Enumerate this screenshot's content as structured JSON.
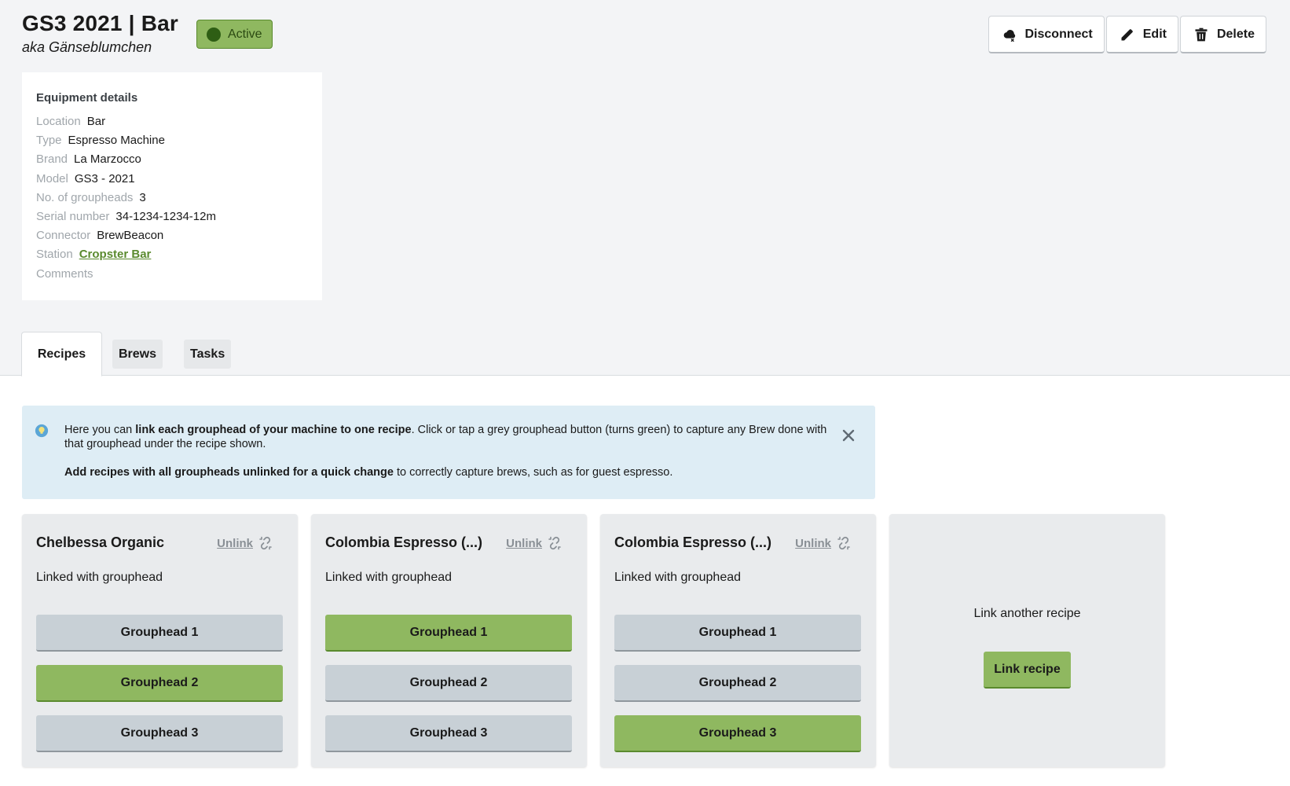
{
  "header": {
    "title": "GS3 2021 | Bar",
    "subtitle": "aka Gänseblumchen",
    "status": "Active",
    "actions": {
      "disconnect": "Disconnect",
      "edit": "Edit",
      "delete": "Delete"
    }
  },
  "details": {
    "heading": "Equipment details",
    "rows": [
      {
        "label": "Location",
        "value": "Bar"
      },
      {
        "label": "Type",
        "value": "Espresso Machine"
      },
      {
        "label": "Brand",
        "value": "La Marzocco"
      },
      {
        "label": "Model",
        "value": "GS3 - 2021"
      },
      {
        "label": "No. of groupheads",
        "value": "3"
      },
      {
        "label": "Serial number",
        "value": "34-1234-1234-12m"
      },
      {
        "label": "Connector",
        "value": "BrewBeacon"
      },
      {
        "label": "Station",
        "value": "Cropster Bar"
      },
      {
        "label": "Comments",
        "value": ""
      }
    ]
  },
  "tabs": [
    "Recipes",
    "Brews",
    "Tasks"
  ],
  "info": {
    "p1_before": "Here you can ",
    "p1_bold": "link each grouphead of your machine to one recipe",
    "p1_after": ". Click or tap a grey grouphead button (turns green) to capture any Brew done with that grouphead under the recipe shown.",
    "p2_bold": "Add recipes with all groupheads unlinked for a quick change",
    "p2_after": " to correctly capture brews, such as for guest espresso."
  },
  "recipes": [
    {
      "name": "Chelbessa Organic",
      "unlink": "Unlink",
      "linked_text": "Linked with grouphead",
      "groupheads": [
        "Grouphead 1",
        "Grouphead 2",
        "Grouphead 3"
      ],
      "active": 2
    },
    {
      "name": "Colombia Espresso (...)",
      "unlink": "Unlink",
      "linked_text": "Linked with grouphead",
      "groupheads": [
        "Grouphead 1",
        "Grouphead 2",
        "Grouphead 3"
      ],
      "active": 1
    },
    {
      "name": "Colombia Espresso (...)",
      "unlink": "Unlink",
      "linked_text": "Linked with grouphead",
      "groupheads": [
        "Grouphead 1",
        "Grouphead 2",
        "Grouphead 3"
      ],
      "active": 3
    }
  ],
  "add_card": {
    "text": "Link another recipe",
    "button": "Link recipe"
  },
  "colors": {
    "green": "#8fb860",
    "dark_green": "#5a8a2e",
    "grey_button": "#c8d0d6",
    "info_bg": "#deedf5"
  }
}
